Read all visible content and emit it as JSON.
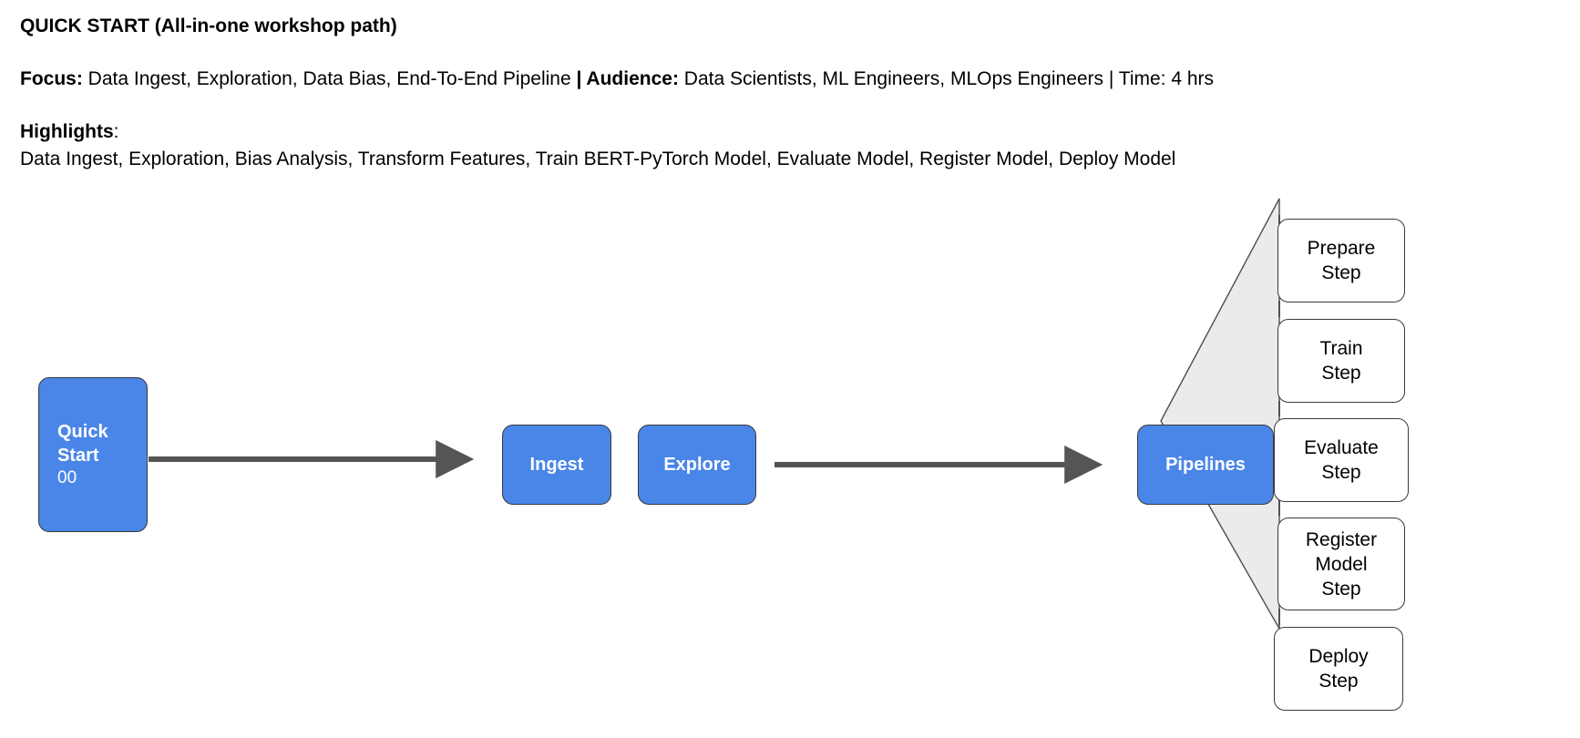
{
  "header": {
    "title": "QUICK START (All-in-one workshop path)",
    "focus_label": "Focus:",
    "focus_value": " Data Ingest, Exploration, Data Bias, End-To-End Pipeline ",
    "separator_1": "| ",
    "audience_label": "Audience:",
    "audience_value": " Data Scientists, ML Engineers, MLOps Engineers | Time: 4 hrs",
    "highlights_label": "Highlights",
    "highlights_colon": ":",
    "highlights_list": "Data Ingest, Exploration, Bias Analysis, Transform Features, Train BERT-PyTorch Model, Evaluate Model, Register Model, Deploy Model"
  },
  "diagram": {
    "start_node": {
      "label": "Quick\nStart",
      "sublabel": "00"
    },
    "stage_nodes": [
      {
        "label": "Ingest"
      },
      {
        "label": "Explore"
      }
    ],
    "pipelines_node": {
      "label": "Pipelines"
    },
    "steps": [
      {
        "label": "Prepare\nStep"
      },
      {
        "label": "Train\nStep"
      },
      {
        "label": "Evaluate\nStep"
      },
      {
        "label": "Register\nModel\nStep"
      },
      {
        "label": "Deploy\nStep"
      }
    ],
    "arrows": [
      {
        "name": "arrow-start-to-ingest"
      },
      {
        "name": "arrow-explore-to-pipelines"
      }
    ]
  },
  "colors": {
    "node_blue": "#4a86e8",
    "node_border": "#3a3a3a",
    "fan_fill": "#ebebeb",
    "fan_stroke": "#4d4d4d",
    "arrow": "#555555",
    "text_light": "#ffffff",
    "text_dark": "#000000",
    "background": "#ffffff"
  }
}
